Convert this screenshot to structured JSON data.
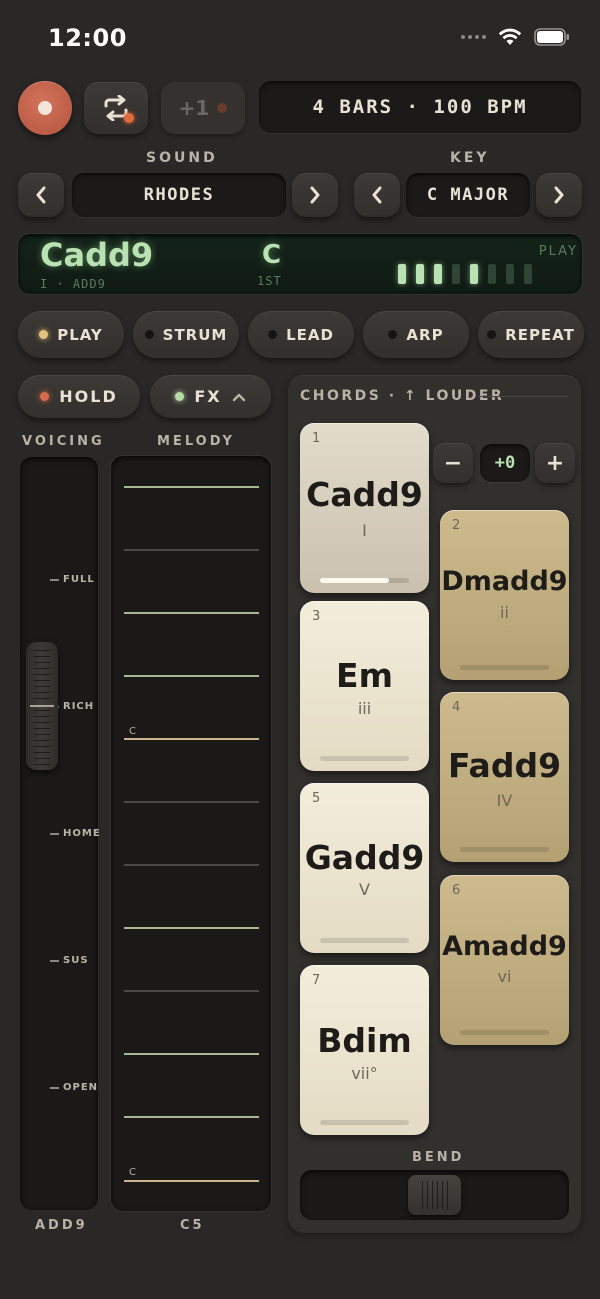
{
  "status": {
    "time": "12:00"
  },
  "transport": {
    "plus_label": "+1",
    "bars_bpm": "4 BARS · 100 BPM"
  },
  "sound": {
    "label": "SOUND",
    "value": "RHODES",
    "prev": "<",
    "next": ">"
  },
  "key": {
    "label": "KEY",
    "value": "C MAJOR",
    "prev": "<",
    "next": ">"
  },
  "display": {
    "chord": "Cadd9",
    "sub": "I · ADD9",
    "root": "C",
    "position": "1ST",
    "mode": "PLAY",
    "meter_levels": [
      1,
      1,
      1,
      0,
      1,
      0,
      0,
      0
    ]
  },
  "modes": [
    {
      "label": "PLAY",
      "active": true
    },
    {
      "label": "STRUM",
      "active": false
    },
    {
      "label": "LEAD",
      "active": false
    },
    {
      "label": "ARP",
      "active": false
    },
    {
      "label": "REPEAT",
      "active": false
    }
  ],
  "hold": {
    "label": "HOLD"
  },
  "fx": {
    "label": "FX",
    "chevron": "^"
  },
  "voicing": {
    "label": "VOICING",
    "marks": [
      "FULL",
      "RICH",
      "HOME",
      "SUS",
      "OPEN"
    ],
    "value": "ADD9"
  },
  "melody": {
    "label": "MELODY",
    "note_labels": [
      "C",
      "C"
    ],
    "value": "C5"
  },
  "chords": {
    "title": "CHORDS · ↑ LOUDER",
    "offset": "+0",
    "minus": "−",
    "plus": "+",
    "pads": [
      {
        "num": "1",
        "name": "Cadd9",
        "degree": "I"
      },
      {
        "num": "2",
        "name": "Dmadd9",
        "degree": "ii"
      },
      {
        "num": "3",
        "name": "Em",
        "degree": "iii"
      },
      {
        "num": "4",
        "name": "Fadd9",
        "degree": "IV"
      },
      {
        "num": "5",
        "name": "Gadd9",
        "degree": "V"
      },
      {
        "num": "6",
        "name": "Amadd9",
        "degree": "vi"
      },
      {
        "num": "7",
        "name": "Bdim",
        "degree": "vii°"
      }
    ],
    "active_pad_level": 0.78
  },
  "bend": {
    "label": "BEND"
  },
  "colors": {
    "background": "#2a2826",
    "lcd_green": "#b9e2b2",
    "record": "#c45f48",
    "pad_light": "#ece5d0",
    "pad_gold": "#c2ae80"
  }
}
